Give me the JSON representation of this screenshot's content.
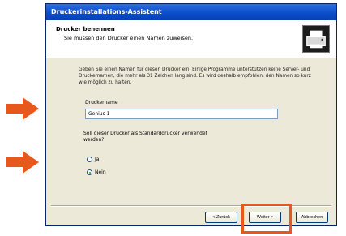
{
  "window": {
    "title": "Druckerinstallations-Assistent"
  },
  "header": {
    "title": "Drucker benennen",
    "subtitle": "Sie müssen den Drucker einen Namen zuweisen."
  },
  "content": {
    "description": "Geben Sie einen Namen für diesen Drucker ein. Einige Programme unterstützen keine Server- und Druckernamen, die mehr als 31 Zeichen lang sind. Es wird deshalb empfohlen, den Namen so kurz wie möglich zu halten.",
    "printer_name_label": "Druckername",
    "printer_name_value": "Genius 1",
    "default_question": "Soll dieser Drucker als Standarddrucker verwendet werden?",
    "options": [
      {
        "label": "Ja",
        "checked": false
      },
      {
        "label": "Nein",
        "checked": true
      }
    ]
  },
  "buttons": {
    "back": "< Zurück",
    "next": "Weiter >",
    "cancel": "Abbrechen"
  },
  "colors": {
    "arrow": "#e8581c",
    "highlight": "#e8581c"
  },
  "icons": {
    "wizard": "printer-wizard-icon",
    "arrows": "arrow-right-icon"
  }
}
